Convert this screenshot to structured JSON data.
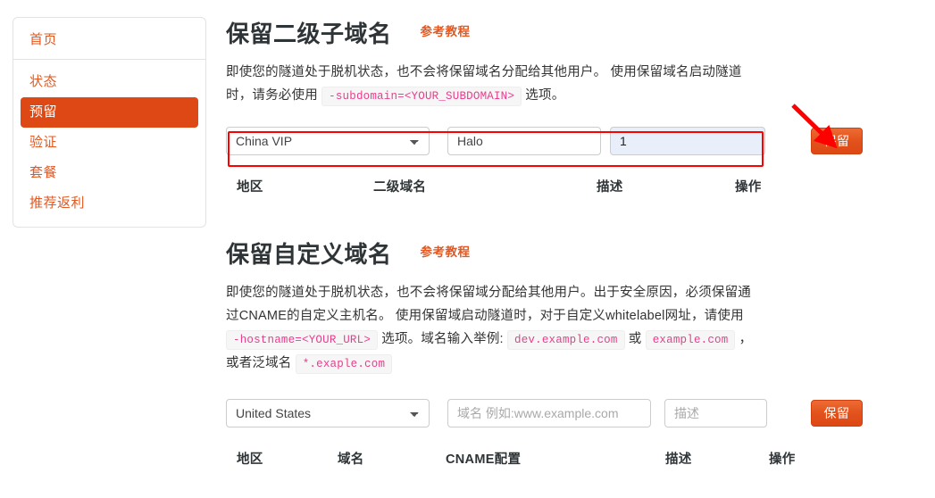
{
  "sidebar": {
    "home": {
      "label": "首页"
    },
    "items": [
      {
        "label": "状态",
        "active": false
      },
      {
        "label": "预留",
        "active": true
      },
      {
        "label": "验证",
        "active": false
      },
      {
        "label": "套餐",
        "active": false
      },
      {
        "label": "推荐返利",
        "active": false
      }
    ]
  },
  "section_subdomain": {
    "title": "保留二级子域名",
    "tutorial_label": "参考教程",
    "desc_part1": "即使您的隧道处于脱机状态，也不会将保留域名分配给其他用户。 使用保留域名启动隧道时，请务必使用 ",
    "desc_code1": "-subdomain=<YOUR_SUBDOMAIN>",
    "desc_part2": " 选项。",
    "form": {
      "region_value": "China VIP",
      "subdomain_value": "Halo",
      "desc_value": "1",
      "button_label": "保留"
    },
    "table_headers": [
      "地区",
      "二级域名",
      "描述",
      "操作"
    ]
  },
  "section_custom": {
    "title": "保留自定义域名",
    "tutorial_label": "参考教程",
    "desc_part1": "即使您的隧道处于脱机状态，也不会将保留域分配给其他用户。出于安全原因，必须保留通过CNAME的自定义主机名。 使用保留域启动隧道时，对于自定义whitelabel网址，请使用 ",
    "desc_code1": "-hostname=<YOUR_URL>",
    "desc_part2": " 选项。域名输入举例: ",
    "desc_code2": "dev.example.com",
    "desc_part3": " 或 ",
    "desc_code3": "example.com",
    "desc_part4": " ，或者泛域名 ",
    "desc_code4": "*.exaple.com",
    "form": {
      "region_value": "United States",
      "domain_placeholder": "域名 例如:www.example.com",
      "desc_placeholder": "描述",
      "button_label": "保留"
    },
    "table_headers": [
      "地区",
      "域名",
      "CNAME配置",
      "描述",
      "操作"
    ]
  },
  "annotations": {
    "highlight_color": "#ff0000",
    "arrow_color": "#ff0000"
  },
  "colors": {
    "brand_orange": "#dd4814",
    "link_orange": "#e25822",
    "code_pink": "#e83e8c",
    "autofill_blue": "#e8eefa"
  }
}
